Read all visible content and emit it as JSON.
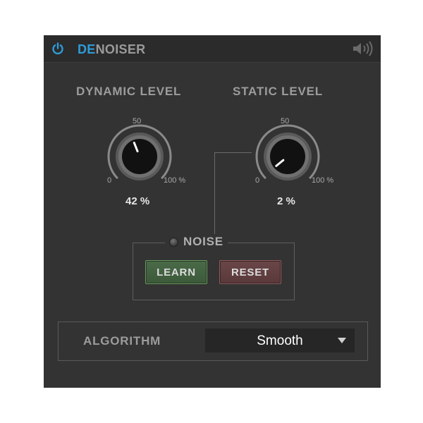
{
  "plugin": {
    "title_accent": "DE",
    "title_rest": "NOISER"
  },
  "dynamic": {
    "label": "DYNAMIC LEVEL",
    "scale_min": "0",
    "scale_mid": "50",
    "scale_max": "100 %",
    "value_text": "42 %",
    "value": 42
  },
  "static": {
    "label": "STATIC LEVEL",
    "scale_min": "0",
    "scale_mid": "50",
    "scale_max": "100 %",
    "value_text": "2 %",
    "value": 2
  },
  "noise": {
    "label": "NOISE",
    "learn_label": "LEARN",
    "reset_label": "RESET"
  },
  "algorithm": {
    "label": "ALGORITHM",
    "selected": "Smooth"
  },
  "colors": {
    "accent": "#2e9bd8",
    "panel": "#333333",
    "learn": "#3c5a3a",
    "reset": "#5a393b"
  },
  "icons": {
    "power": "power-icon",
    "speaker": "speaker-icon",
    "dropdown": "chevron-down-icon"
  }
}
